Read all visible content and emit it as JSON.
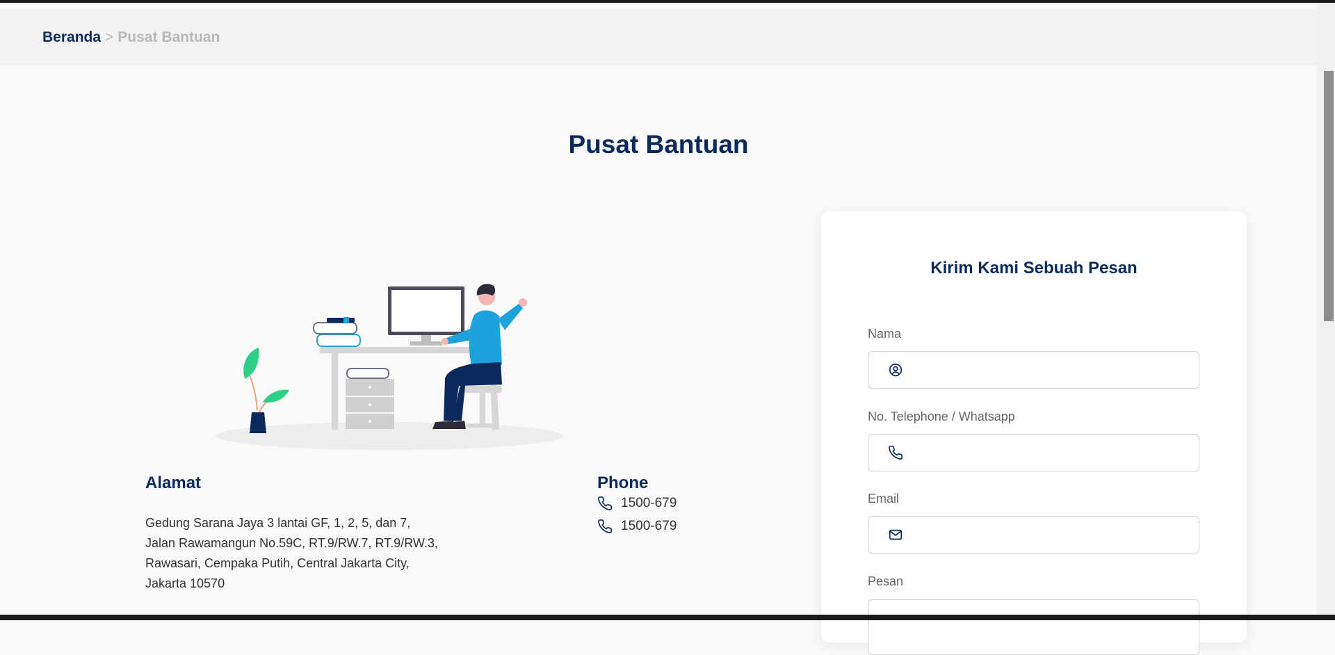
{
  "breadcrumb": {
    "home": "Beranda",
    "separator": ">",
    "current": "Pusat Bantuan"
  },
  "page": {
    "title": "Pusat Bantuan"
  },
  "address": {
    "heading": "Alamat",
    "lines": [
      "Gedung Sarana Jaya 3 lantai GF, 1, 2, 5, dan 7,",
      "Jalan Rawamangun No.59C, RT.9/RW.7, RT.9/RW.3,",
      "Rawasari, Cempaka Putih, Central Jakarta City,",
      "Jakarta 10570"
    ]
  },
  "phone": {
    "heading": "Phone",
    "numbers": [
      "1500-679",
      "1500-679"
    ],
    "icon": "phone-icon"
  },
  "form": {
    "title": "Kirim Kami Sebuah Pesan",
    "fields": [
      {
        "label": "Nama",
        "placeholder": "",
        "icon": "user-circle-icon"
      },
      {
        "label": "No. Telephone / Whatsapp",
        "placeholder": "",
        "icon": "phone-icon"
      },
      {
        "label": "Email",
        "placeholder": "",
        "icon": "mail-icon"
      },
      {
        "label": "Pesan",
        "placeholder": ""
      }
    ]
  },
  "colors": {
    "primary": "#0b2a5b",
    "muted": "#b8b8b8",
    "accent": "#1ea2dc",
    "plant": "#2ecf86"
  }
}
